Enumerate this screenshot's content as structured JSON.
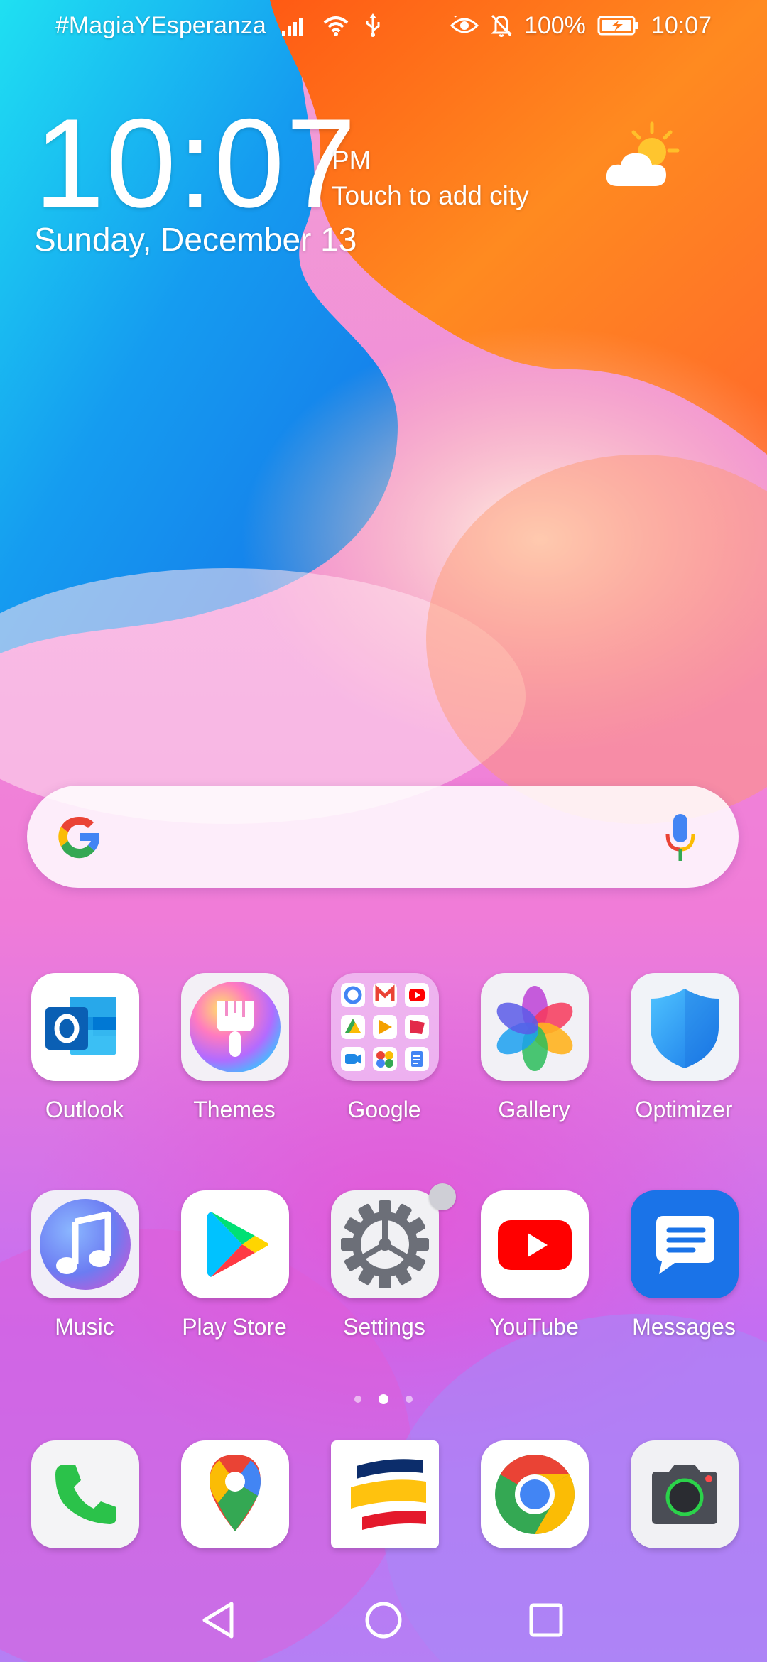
{
  "status_bar": {
    "carrier_text": "#MagiaYEsperanza",
    "battery": "100%",
    "time": "10:07",
    "icons": [
      "signal-icon",
      "wifi-icon",
      "usb-icon",
      "eye-comfort-icon",
      "silent-bell-icon",
      "battery-charging-icon"
    ]
  },
  "clock_widget": {
    "time": "10:07",
    "ampm": "PM",
    "city_prompt": "Touch to add city",
    "date": "Sunday, December 13",
    "weather_icon": "partly-cloudy-icon"
  },
  "search_bar": {
    "logo": "google-g-icon",
    "mic": "microphone-icon"
  },
  "apps": [
    {
      "label": "Outlook",
      "icon": "outlook-icon"
    },
    {
      "label": "Themes",
      "icon": "themes-brush-icon"
    },
    {
      "label": "Google",
      "icon": "google-folder-icon"
    },
    {
      "label": "Gallery",
      "icon": "gallery-flower-icon"
    },
    {
      "label": "Optimizer",
      "icon": "shield-icon"
    },
    {
      "label": "Music",
      "icon": "music-note-icon"
    },
    {
      "label": "Play Store",
      "icon": "play-store-icon"
    },
    {
      "label": "Settings",
      "icon": "gear-icon"
    },
    {
      "label": "YouTube",
      "icon": "youtube-icon"
    },
    {
      "label": "Messages",
      "icon": "messages-icon"
    }
  ],
  "page_indicator": {
    "pages": 3,
    "current": 2
  },
  "dock": [
    {
      "icon": "phone-icon"
    },
    {
      "icon": "maps-pin-icon"
    },
    {
      "icon": "bank-flag-icon"
    },
    {
      "icon": "chrome-icon"
    },
    {
      "icon": "camera-icon"
    }
  ],
  "nav_bar": {
    "buttons": [
      "back-triangle-icon",
      "home-circle-icon",
      "recents-square-icon"
    ]
  },
  "colors": {
    "wallpaper_blue": "#1aa6f0",
    "wallpaper_orange": "#ff7a1a",
    "wallpaper_pink": "#f79ad2",
    "wallpaper_purple": "#c66ef2",
    "youtube_red": "#ff0000",
    "messages_blue": "#1a73e8"
  }
}
